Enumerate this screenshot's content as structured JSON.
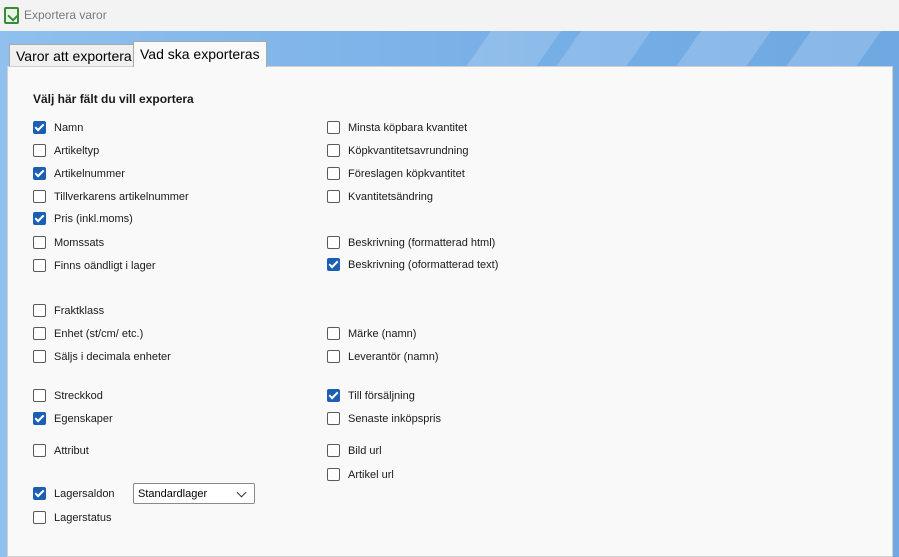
{
  "window": {
    "title": "Exportera varor"
  },
  "tabs": [
    {
      "label": "Varor att exportera",
      "active": false
    },
    {
      "label": "Vad ska exporteras",
      "active": true
    }
  ],
  "panel": {
    "heading": "Välj här fält du vill exportera"
  },
  "fields": [
    {
      "label": "Namn",
      "checked": true
    },
    {
      "label": "Artikeltyp",
      "checked": false
    },
    {
      "label": "Artikelnummer",
      "checked": true
    },
    {
      "label": "Tillverkarens artikelnummer",
      "checked": false
    },
    {
      "label": "Pris (inkl.moms)",
      "checked": true
    },
    {
      "label": "Momssats",
      "checked": false
    },
    {
      "label": "Finns oändligt i lager",
      "checked": false
    },
    {
      "label": "Fraktklass",
      "checked": false
    },
    {
      "label": "Enhet (st/cm/ etc.)",
      "checked": false
    },
    {
      "label": "Säljs i decimala enheter",
      "checked": false
    },
    {
      "label": "Streckkod",
      "checked": false
    },
    {
      "label": "Egenskaper",
      "checked": true
    },
    {
      "label": "Attribut",
      "checked": false
    },
    {
      "label": "Lagersaldon",
      "checked": true
    },
    {
      "label": "Lagerstatus",
      "checked": false
    },
    {
      "label": "Minsta köpbara kvantitet",
      "checked": false
    },
    {
      "label": "Köpkvantitetsavrundning",
      "checked": false
    },
    {
      "label": "Föreslagen köpkvantitet",
      "checked": false
    },
    {
      "label": "Kvantitetsändring",
      "checked": false
    },
    {
      "label": "Beskrivning (formatterad html)",
      "checked": false
    },
    {
      "label": "Beskrivning (oformatterad text)",
      "checked": true
    },
    {
      "label": "Märke (namn)",
      "checked": false
    },
    {
      "label": "Leverantör (namn)",
      "checked": false
    },
    {
      "label": "Till försäljning",
      "checked": true
    },
    {
      "label": "Senaste inköpspris",
      "checked": false
    },
    {
      "label": "Bild url",
      "checked": false
    },
    {
      "label": "Artikel url",
      "checked": false
    }
  ],
  "warehouse_select": {
    "value": "Standardlager"
  }
}
